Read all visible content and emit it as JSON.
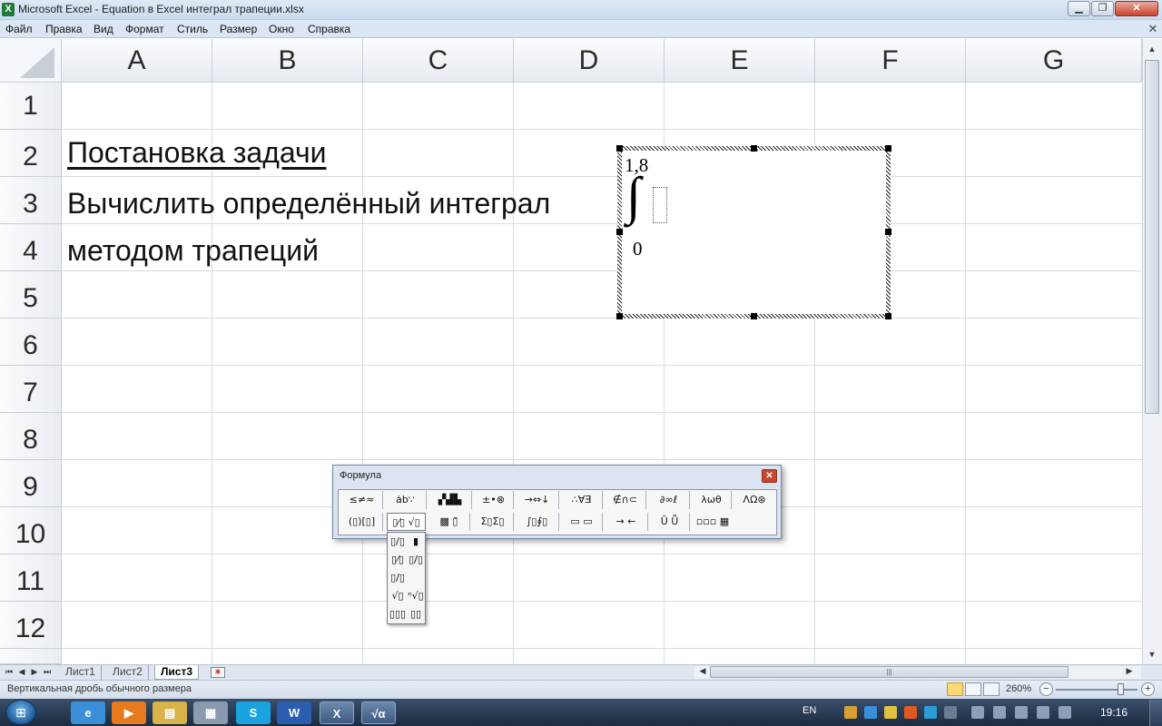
{
  "window": {
    "title": "Microsoft Excel - Equation в Excel интеграл трапеции.xlsx",
    "app_icon": "X",
    "controls": {
      "minimize": "▁",
      "maximize": "❐",
      "close": "✕"
    }
  },
  "menu": {
    "items": [
      "Файл",
      "Правка",
      "Вид",
      "Формат",
      "Стиль",
      "Размер",
      "Окно",
      "Справка"
    ],
    "close_doc": "✕"
  },
  "columns": [
    "A",
    "B",
    "C",
    "D",
    "E",
    "F",
    "G"
  ],
  "rows": [
    "1",
    "2",
    "3",
    "4",
    "5",
    "6",
    "7",
    "8",
    "9",
    "10",
    "11",
    "12"
  ],
  "cells": {
    "title": "Постановка задачи",
    "line1": "Вычислить определённый интеграл",
    "line2": "методом трапеций"
  },
  "equation": {
    "upper_limit": "1,8",
    "integral_sign": "∫",
    "lower_limit": "0"
  },
  "formula_toolbar": {
    "title": "Формула",
    "close": "✕",
    "row1": [
      "≤≠≈",
      "ȧb∵",
      "▞▟▙",
      "±•⊗",
      "→⇔↓",
      "∴∀∃",
      "∉∩⊂",
      "∂∞ℓ",
      "λωθ",
      "ΛΩ⊛"
    ],
    "row2": [
      "(▯)[▯]",
      "▯⁄▯ √▯",
      "▩ ▯̄",
      "Σ▯Σ▯",
      "∫▯∮▯",
      "▭ ▭",
      "→ ←",
      "Ũ Ṻ",
      "▫▫▫ ▦"
    ],
    "dropdown": [
      "▯/▯",
      "▮",
      "▯⁄▯",
      "▯/▯",
      "▯/▯",
      "√▯",
      "ⁿ√▯",
      "▯▯▯",
      "▯▯"
    ]
  },
  "scrollbar": {
    "up": "▲",
    "down": "▼",
    "left": "◀",
    "right": "▶",
    "grip": "|||"
  },
  "sheet_tabs": {
    "nav": [
      "⏮",
      "◀",
      "▶",
      "⏭"
    ],
    "tabs": [
      "Лист1",
      "Лист2",
      "Лист3"
    ],
    "active": "Лист3",
    "new_sheet_icon": "✱"
  },
  "status_bar": {
    "message": "Вертикальная дробь обычного размера",
    "zoom": "260%",
    "zoom_minus": "−",
    "zoom_plus": "+"
  },
  "taskbar": {
    "start": "⊞",
    "apps": [
      {
        "name": "ie",
        "glyph": "e",
        "color": "#3a8fd8"
      },
      {
        "name": "media-player",
        "glyph": "▶",
        "color": "#e77a1c"
      },
      {
        "name": "explorer",
        "glyph": "▤",
        "color": "#d9b24a"
      },
      {
        "name": "calculator",
        "glyph": "▦",
        "color": "#8a9bb0"
      },
      {
        "name": "skype",
        "glyph": "S",
        "color": "#1aa3e0"
      },
      {
        "name": "word",
        "glyph": "W",
        "color": "#2b5db0"
      },
      {
        "name": "excel",
        "glyph": "X",
        "color": "#1f8a43"
      },
      {
        "name": "equation-editor",
        "glyph": "√α",
        "color": "#c03030"
      }
    ],
    "language": "EN",
    "clock": "19:16"
  },
  "colors": {
    "titlebar": "#dfe9f5",
    "grid_line": "#dadcdd",
    "header_bg": "#e6ebf1",
    "taskbar": "#1c2b40"
  }
}
